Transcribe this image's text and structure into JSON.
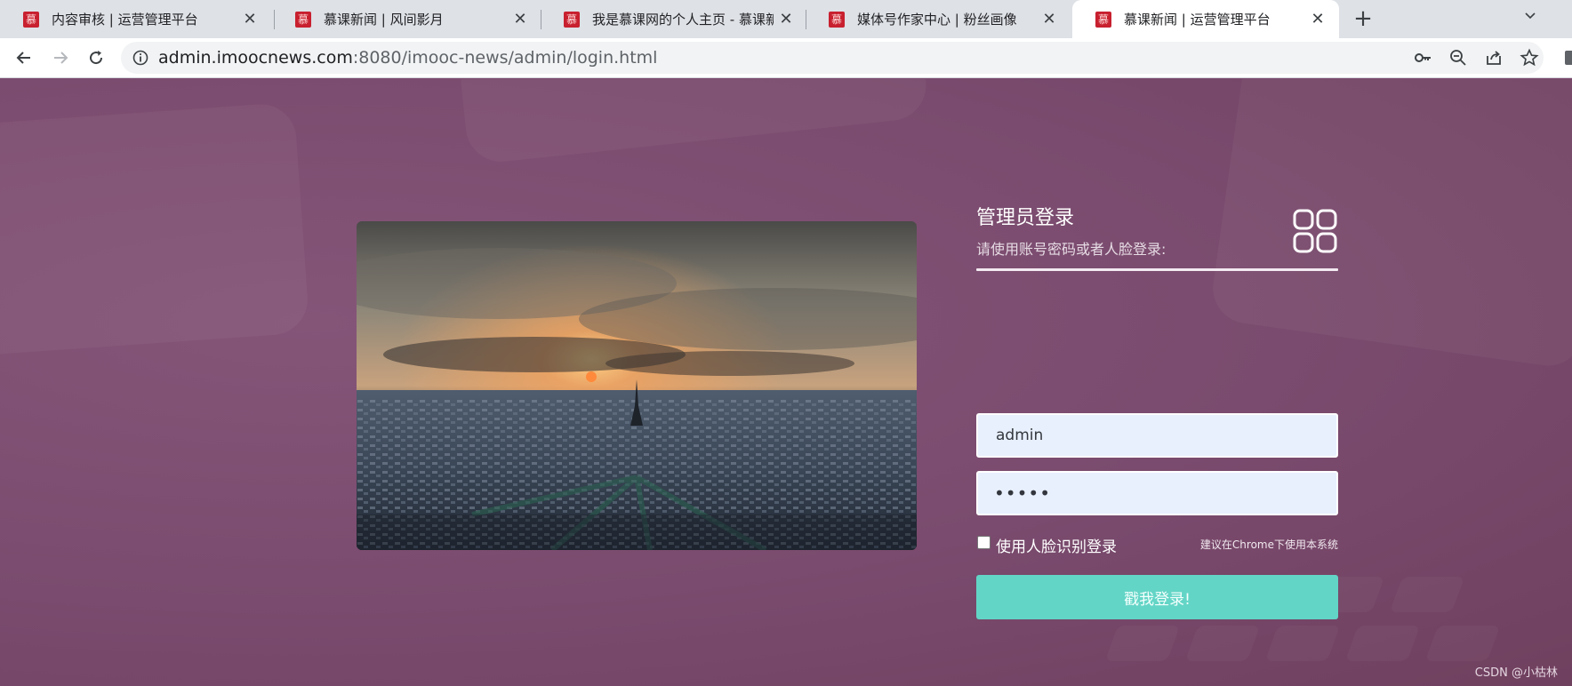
{
  "browser": {
    "tabs": [
      {
        "title": "内容审核 | 运营管理平台",
        "favicon": "慕",
        "active": false
      },
      {
        "title": "慕课新闻 | 风间影月",
        "favicon": "慕",
        "active": false
      },
      {
        "title": "我是慕课网的个人主页 - 慕课新闻",
        "favicon": "慕",
        "active": false
      },
      {
        "title": "媒体号作家中心 | 粉丝画像",
        "favicon": "慕",
        "active": false
      },
      {
        "title": "慕课新闻 | 运营管理平台",
        "favicon": "慕",
        "active": true
      }
    ],
    "close_glyph": "✕",
    "new_tab_glyph": "+",
    "url_host": "admin.imoocnews.com",
    "url_rest": ":8080/imooc-news/admin/login.html",
    "icons": [
      "back-arrow-icon",
      "forward-arrow-icon",
      "reload-icon",
      "info-icon",
      "key-icon",
      "zoom-out-icon",
      "share-icon",
      "star-icon",
      "chevron-down-icon"
    ]
  },
  "login": {
    "title": "管理员登录",
    "subtitle": "请使用账号密码或者人脸登录:",
    "username_value": "admin",
    "password_value": "•••••",
    "face_label": "使用人脸识别登录",
    "face_hint": "建议在Chrome下使用本系统",
    "button_label": "戳我登录!",
    "button_color": "#63d5c6",
    "input_bg": "#e8f0fe"
  },
  "watermark": "CSDN @小枯林",
  "colors": {
    "page_bg": "#7c4c70",
    "tabbar_bg": "#dee1e6"
  }
}
